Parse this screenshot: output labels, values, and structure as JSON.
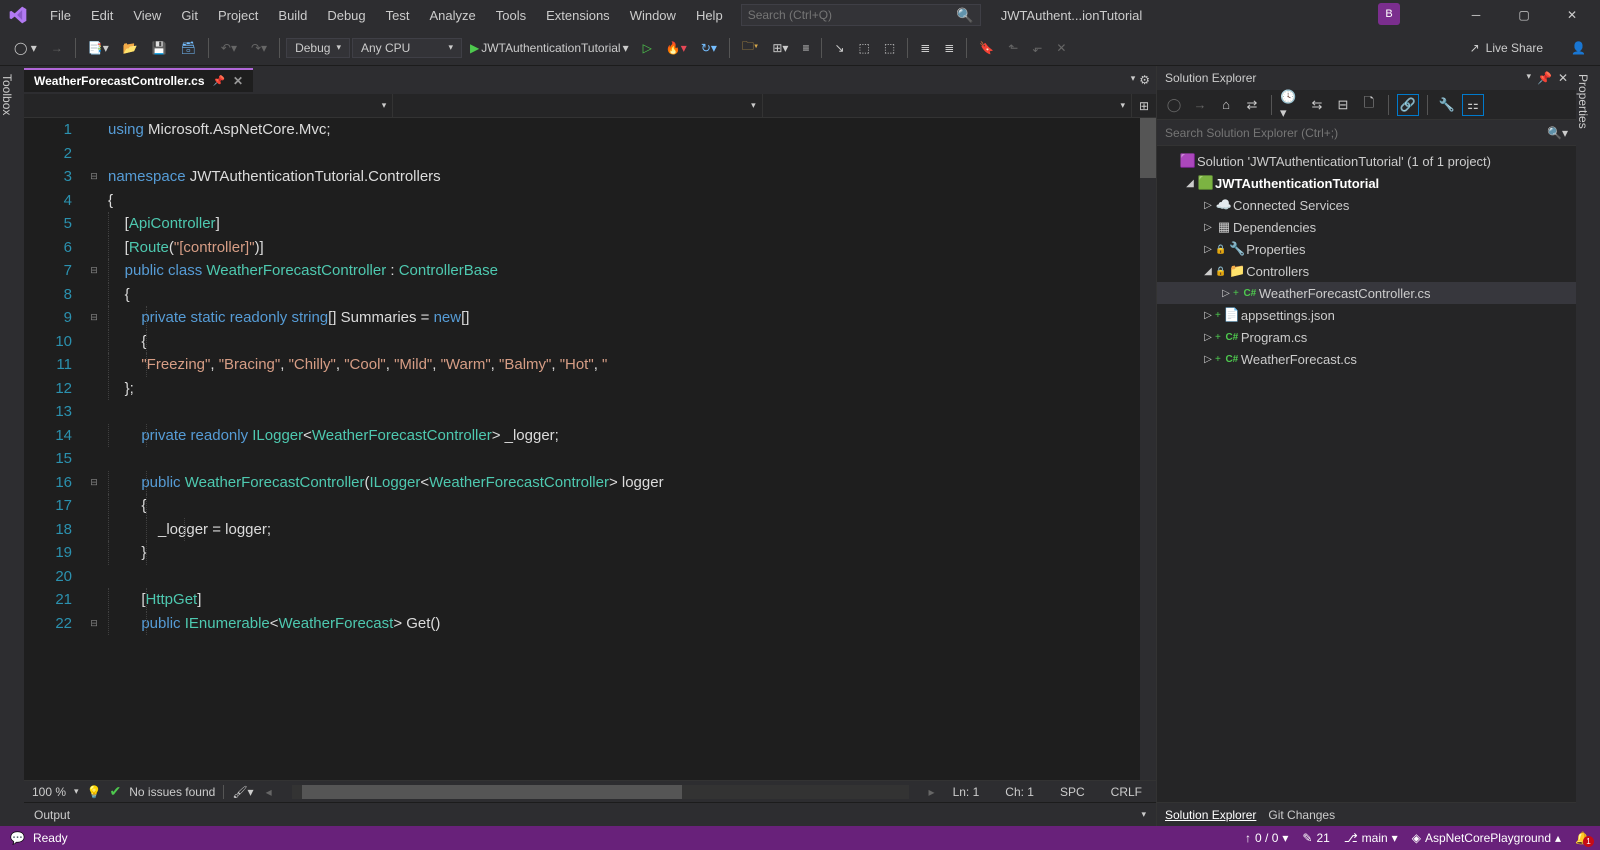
{
  "title": {
    "app": "JWTAuthent...ionTutorial",
    "avatar": "B"
  },
  "menu": [
    "File",
    "Edit",
    "View",
    "Git",
    "Project",
    "Build",
    "Debug",
    "Test",
    "Analyze",
    "Tools",
    "Extensions",
    "Window",
    "Help"
  ],
  "search": {
    "placeholder": "Search (Ctrl+Q)"
  },
  "toolbar": {
    "config": "Debug",
    "platform": "Any CPU",
    "start_label": "JWTAuthenticationTutorial",
    "live_share": "Live Share"
  },
  "left_rail": "Toolbox",
  "right_rail": "Properties",
  "tab": {
    "name": "WeatherForecastController.cs"
  },
  "code": {
    "lines": [
      {
        "n": 1,
        "html": "<span class='kw'>using</span> Microsoft.AspNetCore.Mvc;"
      },
      {
        "n": 2,
        "html": ""
      },
      {
        "n": 3,
        "html": "<span class='kw'>namespace</span> JWTAuthenticationTutorial.Controllers"
      },
      {
        "n": 4,
        "html": "{"
      },
      {
        "n": 5,
        "html": "    [<span class='attr'>ApiController</span>]"
      },
      {
        "n": 6,
        "html": "    [<span class='attr'>Route</span>(<span class='str'>\"[controller]\"</span>)]"
      },
      {
        "n": 7,
        "html": "    <span class='kw'>public</span> <span class='kw'>class</span> <span class='cls'>WeatherForecastController</span> : <span class='cls'>ControllerBase</span>"
      },
      {
        "n": 8,
        "html": "    {"
      },
      {
        "n": 9,
        "html": "        <span class='kw'>private</span> <span class='kw'>static</span> <span class='kw'>readonly</span> <span class='kw'>string</span>[] Summaries = <span class='kw'>new</span>[]"
      },
      {
        "n": 10,
        "html": "        {"
      },
      {
        "n": 11,
        "html": "        <span class='str'>\"Freezing\"</span>, <span class='str'>\"Bracing\"</span>, <span class='str'>\"Chilly\"</span>, <span class='str'>\"Cool\"</span>, <span class='str'>\"Mild\"</span>, <span class='str'>\"Warm\"</span>, <span class='str'>\"Balmy\"</span>, <span class='str'>\"Hot\"</span>, <span class='str'>\"</span>"
      },
      {
        "n": 12,
        "html": "    };"
      },
      {
        "n": 13,
        "html": ""
      },
      {
        "n": 14,
        "html": "        <span class='kw'>private</span> <span class='kw'>readonly</span> <span class='cls'>ILogger</span>&lt;<span class='cls'>WeatherForecastController</span>&gt; _logger;"
      },
      {
        "n": 15,
        "html": ""
      },
      {
        "n": 16,
        "html": "        <span class='kw'>public</span> <span class='cls'>WeatherForecastController</span>(<span class='cls'>ILogger</span>&lt;<span class='cls'>WeatherForecastController</span>&gt; logger"
      },
      {
        "n": 17,
        "html": "        {"
      },
      {
        "n": 18,
        "html": "            _logger = logger;"
      },
      {
        "n": 19,
        "html": "        }"
      },
      {
        "n": 20,
        "html": ""
      },
      {
        "n": 21,
        "html": "        [<span class='attr'>HttpGet</span>]"
      },
      {
        "n": 22,
        "html": "        <span class='kw'>public</span> <span class='cls'>IEnumerable</span>&lt;<span class='cls'>WeatherForecast</span>&gt; Get()"
      }
    ],
    "folds": {
      "3": "⊟",
      "7": "⊟",
      "9": "⊟",
      "16": "⊟",
      "22": "⊟"
    }
  },
  "editor_status": {
    "zoom": "100 %",
    "issues": "No issues found",
    "line": "Ln: 1",
    "ch": "Ch: 1",
    "enc": "SPC",
    "eol": "CRLF"
  },
  "solution": {
    "title": "Solution Explorer",
    "search_placeholder": "Search Solution Explorer (Ctrl+;)",
    "tree": [
      {
        "d": 0,
        "arrow": "",
        "ico": "sln",
        "label": "Solution 'JWTAuthenticationTutorial' (1 of 1 project)"
      },
      {
        "d": 1,
        "arrow": "◢",
        "ico": "csproj",
        "label": "JWTAuthenticationTutorial",
        "bold": true
      },
      {
        "d": 2,
        "arrow": "▷",
        "ico": "conn",
        "label": "Connected Services"
      },
      {
        "d": 2,
        "arrow": "▷",
        "ico": "dep",
        "label": "Dependencies"
      },
      {
        "d": 2,
        "arrow": "▷",
        "ico": "prop",
        "label": "Properties",
        "lock": true
      },
      {
        "d": 2,
        "arrow": "◢",
        "ico": "folder",
        "label": "Controllers",
        "lock": true
      },
      {
        "d": 3,
        "arrow": "▷",
        "ico": "cs",
        "label": "WeatherForecastController.cs",
        "sel": true,
        "add": true
      },
      {
        "d": 2,
        "arrow": "▷",
        "ico": "json",
        "label": "appsettings.json",
        "add": true
      },
      {
        "d": 2,
        "arrow": "▷",
        "ico": "cs",
        "label": "Program.cs",
        "add": true
      },
      {
        "d": 2,
        "arrow": "▷",
        "ico": "cs",
        "label": "WeatherForecast.cs",
        "add": true
      }
    ],
    "tabs": [
      "Solution Explorer",
      "Git Changes"
    ]
  },
  "output": {
    "title": "Output"
  },
  "statusbar": {
    "ready": "Ready",
    "errors": "0 / 0",
    "changes": "21",
    "branch": "main",
    "repo": "AspNetCorePlayground"
  }
}
